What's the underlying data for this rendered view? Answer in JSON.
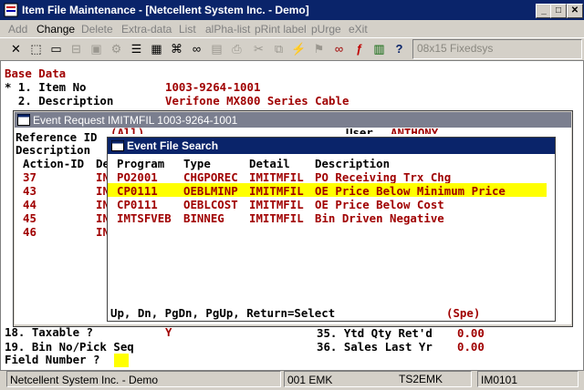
{
  "window": {
    "title": "Item File Maintenance - [Netcellent System Inc. - Demo]"
  },
  "menu": [
    {
      "label": "Add",
      "enabled": false
    },
    {
      "label": "Change",
      "enabled": true
    },
    {
      "label": "Delete",
      "enabled": false
    },
    {
      "label": "Extra-data",
      "enabled": false
    },
    {
      "label": "List",
      "enabled": false
    },
    {
      "label": "alPha-list",
      "enabled": false
    },
    {
      "label": "pRint label",
      "enabled": false
    },
    {
      "label": "pUrge",
      "enabled": false
    },
    {
      "label": "eXit",
      "enabled": false
    }
  ],
  "toolbar": {
    "font_select": "08x15 Fixedsys"
  },
  "base": {
    "header": "Base Data",
    "line1_label": "* 1. Item No",
    "line1_value": "1003-9264-1001",
    "line2_label": "  2. Description",
    "line2_value": "Verifone MX800 Series Cable"
  },
  "event_request": {
    "title": "Event Request IMITMFIL 1003-9264-1001",
    "ref_label": "Reference ID",
    "ref_value": "(All)",
    "user_label": "User",
    "user_value": "ANTHONY",
    "desc_label": "Description",
    "col_action_id": "Action-ID",
    "col_de": "De",
    "rows": [
      {
        "id": "37",
        "de": "IN"
      },
      {
        "id": "43",
        "de": "IN"
      },
      {
        "id": "44",
        "de": "IN"
      },
      {
        "id": "45",
        "de": "IN"
      },
      {
        "id": "46",
        "de": "IN"
      }
    ]
  },
  "search": {
    "title": "Event File Search",
    "col_program": "Program",
    "col_type": "Type",
    "col_detail": "Detail",
    "col_description": "Description",
    "rows": [
      {
        "program": "PO2001",
        "type": "CHGPOREC",
        "detail": "IMITMFIL",
        "description": "PO Receiving Trx Chg"
      },
      {
        "program": "CP0111",
        "type": "OEBLMINP",
        "detail": "IMITMFIL",
        "description": "OE Price Below Minimum Price"
      },
      {
        "program": "CP0111",
        "type": "OEBLCOST",
        "detail": "IMITMFIL",
        "description": "OE Price Below Cost"
      },
      {
        "program": "IMTSFVEB",
        "type": "BINNEG",
        "detail": "IMITMFIL",
        "description": "Bin Driven Negative"
      }
    ],
    "hint": "Up, Dn, PgDn, PgUp, Return=Select",
    "hint_right": "(Spe)"
  },
  "fields": {
    "f18_label": "18. Taxable ?",
    "f18_value": "Y",
    "f19_label": "19. Bin No/Pick Seq",
    "f35_label": "35. Ytd Qty Ret'd",
    "f35_value": "0.00",
    "f36_label": "36. Sales Last Yr",
    "f36_value": "0.00",
    "prompt": "Field Number ?"
  },
  "status": {
    "company": "Netcellent System Inc. - Demo",
    "user": "001 EMK",
    "terminal": "TS2EMK",
    "program": "IM0101"
  }
}
